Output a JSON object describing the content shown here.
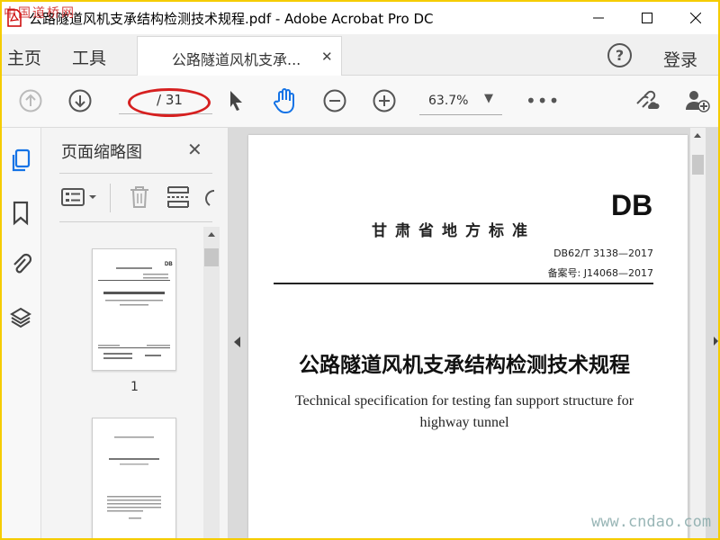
{
  "window": {
    "title": "公路隧道风机支承结构检测技术规程.pdf - Adobe Acrobat Pro DC",
    "watermark_top": "中国道桥网",
    "watermark_bottom": "www.cndao.com"
  },
  "tabbar": {
    "home": "主页",
    "tools": "工具",
    "doc_tab": "公路隧道风机支承...",
    "login": "登录"
  },
  "toolbar": {
    "page_current": "",
    "page_total": "/ 31",
    "zoom": "63.7%"
  },
  "panel": {
    "title": "页面缩略图",
    "thumb1_num": "1"
  },
  "document": {
    "db": "DB",
    "std_title": "甘肃省地方标准",
    "code": "DB62/T 3138—2017",
    "record": "备案号: J14068—2017",
    "title_zh": "公路隧道风机支承结构检测技术规程",
    "title_en": "Technical specification for testing fan support structure for highway tunnel"
  },
  "colors": {
    "accent": "#1473e6",
    "annotation": "#d62020",
    "frame": "#f5cc00"
  }
}
